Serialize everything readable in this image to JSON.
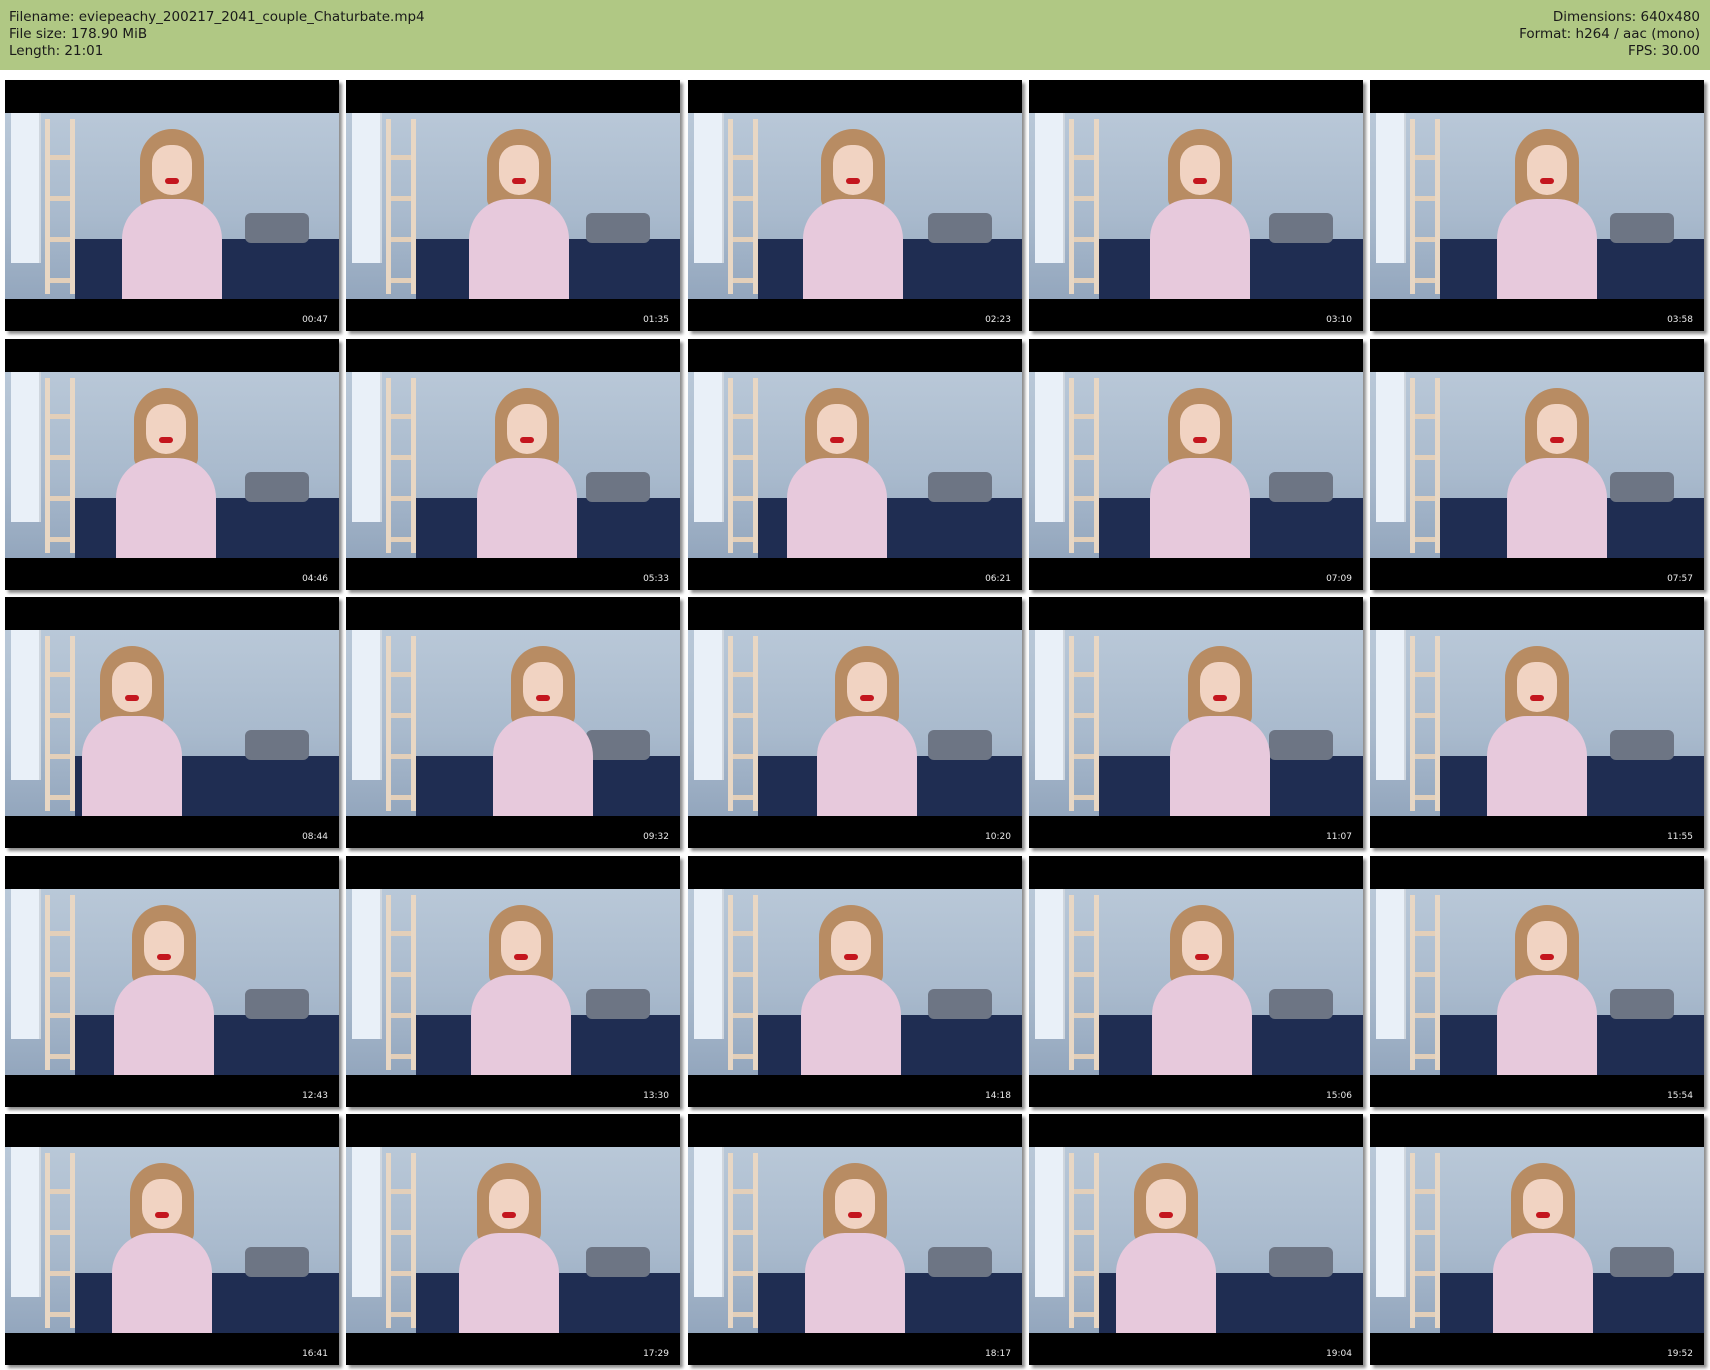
{
  "header": {
    "filename": "Filename: eviepeachy_200217_2041_couple_Chaturbate.mp4",
    "filesize": "File size: 178.90 MiB",
    "length": "Length: 21:01",
    "dimensions": "Dimensions: 640x480",
    "format": "Format: h264 / aac (mono)",
    "fps": "FPS: 30.00",
    "background_color": "#b0c884"
  },
  "thumbnails": [
    {
      "timestamp": "00:47"
    },
    {
      "timestamp": "01:35"
    },
    {
      "timestamp": "02:23"
    },
    {
      "timestamp": "03:10"
    },
    {
      "timestamp": "03:58"
    },
    {
      "timestamp": "04:46"
    },
    {
      "timestamp": "05:33"
    },
    {
      "timestamp": "06:21"
    },
    {
      "timestamp": "07:09"
    },
    {
      "timestamp": "07:57"
    },
    {
      "timestamp": "08:44"
    },
    {
      "timestamp": "09:32"
    },
    {
      "timestamp": "10:20"
    },
    {
      "timestamp": "11:07"
    },
    {
      "timestamp": "11:55"
    },
    {
      "timestamp": "12:43"
    },
    {
      "timestamp": "13:30"
    },
    {
      "timestamp": "14:18"
    },
    {
      "timestamp": "15:06"
    },
    {
      "timestamp": "15:54"
    },
    {
      "timestamp": "16:41"
    },
    {
      "timestamp": "17:29"
    },
    {
      "timestamp": "18:17"
    },
    {
      "timestamp": "19:04"
    },
    {
      "timestamp": "19:52"
    }
  ]
}
